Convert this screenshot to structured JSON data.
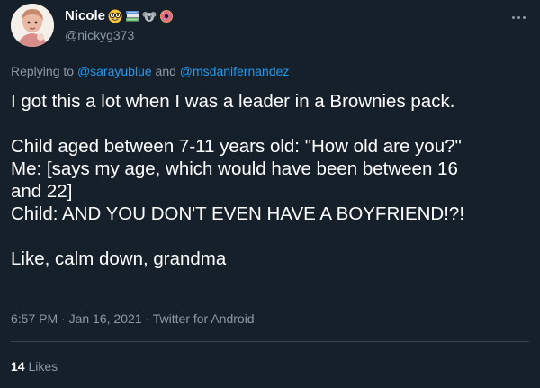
{
  "tweet": {
    "author": {
      "display_name": "Nicole",
      "handle": "@nickyg373",
      "name_emojis": [
        "nerd-face-emoji",
        "books-emoji",
        "koala-emoji",
        "donut-emoji"
      ]
    },
    "more_icon": "more-dots-icon",
    "reply": {
      "prefix": "Replying to",
      "mention_1": "@sarayublue",
      "conjunction": "and",
      "mention_2": "@msdanifernandez"
    },
    "body": {
      "line_1": "I got this a lot when I was a leader in a Brownies pack.",
      "line_2": "Child aged between 7-11 years old: \"How old are you?\"",
      "line_3": "Me: [says my age, which would have been between 16",
      "line_4": "and 22]",
      "line_5": "Child: AND YOU DON'T EVEN HAVE A BOYFRIEND!?!",
      "line_6": "Like, calm down, grandma"
    },
    "meta": {
      "time": "6:57 PM",
      "separator": "·",
      "date": "Jan 16, 2021",
      "source": "Twitter for Android"
    },
    "likes": {
      "count": "14",
      "label": "Likes"
    }
  },
  "colors": {
    "background": "#15202b",
    "text_primary": "#ffffff",
    "text_secondary": "#8b98a5",
    "accent": "#1d9bf0",
    "divider": "#38444d"
  }
}
